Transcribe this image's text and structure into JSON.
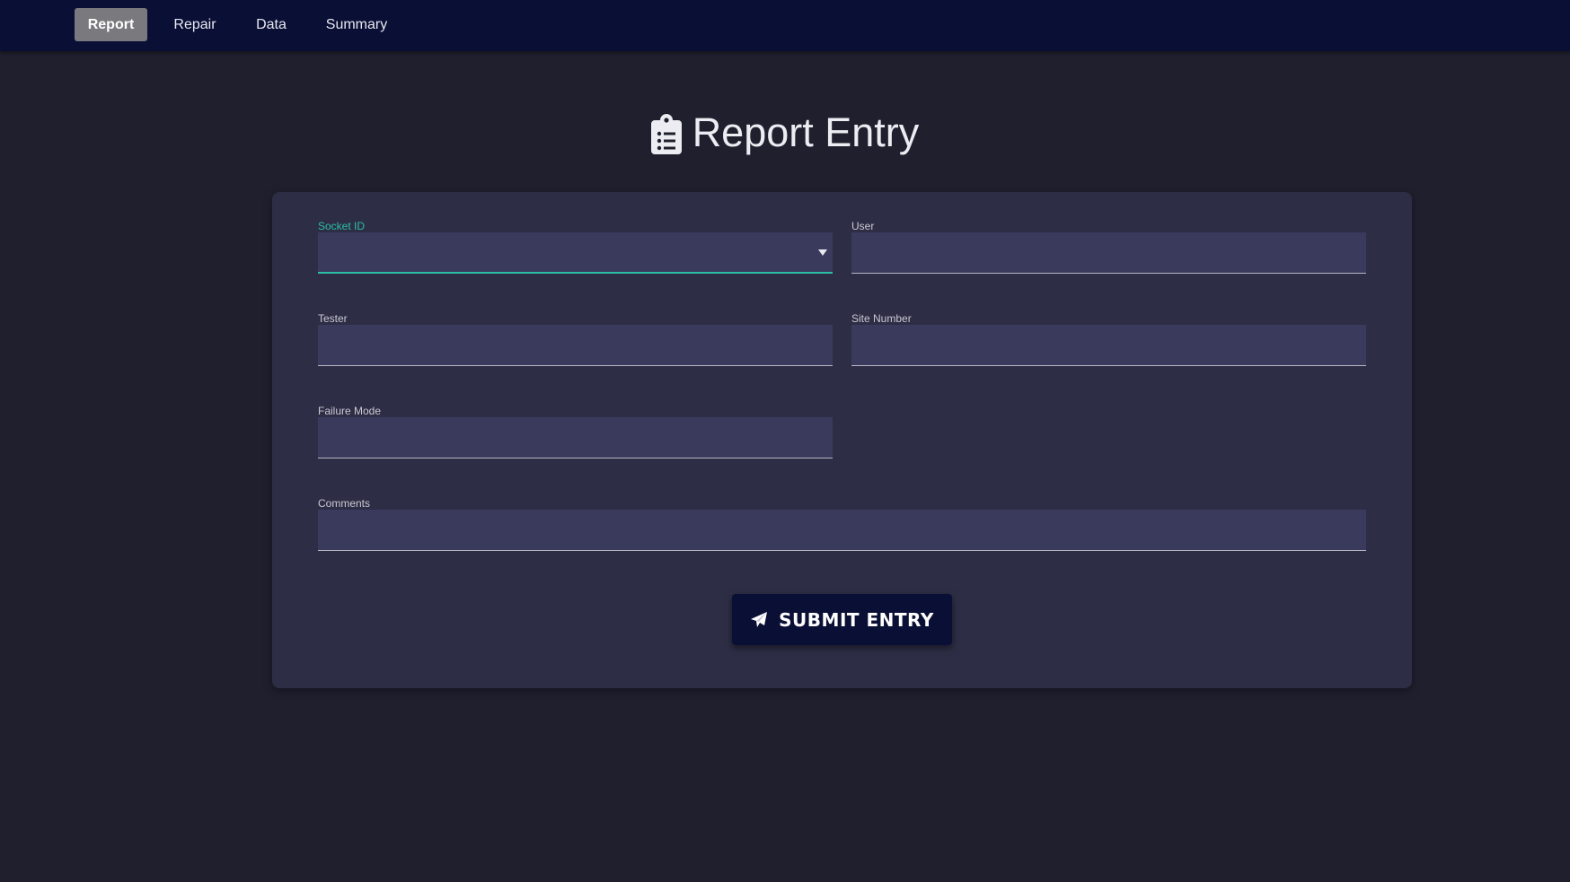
{
  "nav": {
    "items": [
      {
        "label": "Report",
        "active": true
      },
      {
        "label": "Repair",
        "active": false
      },
      {
        "label": "Data",
        "active": false
      },
      {
        "label": "Summary",
        "active": false
      }
    ]
  },
  "page": {
    "title": "Report Entry",
    "title_icon": "clipboard-list-icon"
  },
  "form": {
    "socket_id": {
      "label": "Socket ID",
      "value": ""
    },
    "user": {
      "label": "User",
      "value": ""
    },
    "tester": {
      "label": "Tester",
      "value": ""
    },
    "site_number": {
      "label": "Site Number",
      "value": ""
    },
    "failure_mode": {
      "label": "Failure Mode",
      "value": ""
    },
    "comments": {
      "label": "Comments",
      "value": ""
    },
    "submit_label": "SUBMIT ENTRY",
    "submit_icon": "paper-plane-icon"
  },
  "colors": {
    "navbar": "#0a0f35",
    "background": "#1f1f2e",
    "card": "#2d2d45",
    "input": "#3a3a5c",
    "accent": "#2bbfa4",
    "active_tab": "#7a7a7e"
  }
}
